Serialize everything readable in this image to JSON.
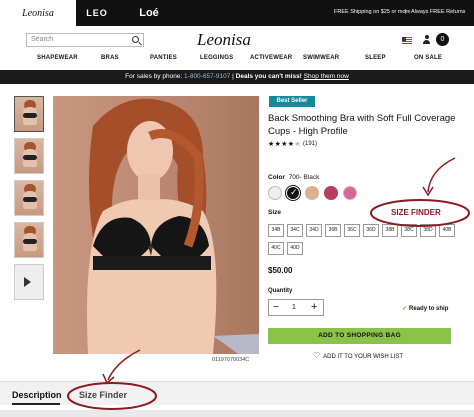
{
  "topbar": {
    "brands": [
      "Leonisa",
      "LEO",
      "Loé"
    ],
    "shipping_msg": "FREE Shipping on $25 or more",
    "separator": "|",
    "returns_msg": "Always FREE Returns"
  },
  "header": {
    "search_placeholder": "Search",
    "logo": "Leonisa",
    "cart_count": "0"
  },
  "nav": [
    "SHAPEWEAR",
    "BRAS",
    "PANTIES",
    "LEGGINGS",
    "ACTIVEWEAR",
    "SWIMWEAR",
    "SLEEP",
    "ON SALE"
  ],
  "promo": {
    "prefix": "For sales by phone:",
    "phone": "1-800-657-9107",
    "divider": "|",
    "deals": "Deals you can't miss!",
    "link": "Shop them now"
  },
  "product": {
    "badge": "Best Seller",
    "title": "Back Smoothing Bra with Soft Full Coverage Cups - High Profile",
    "rating": 4,
    "rating_max": 5,
    "reviews": "(191)",
    "color_label": "Color",
    "color_value": "700- Black",
    "swatch_colors": [
      "#eeeeee",
      "#111111",
      "#d9b190",
      "#b73d61",
      "#d26898"
    ],
    "size_label": "Size",
    "sizes_row1": [
      "34B",
      "34C",
      "34D",
      "36B",
      "36C",
      "36D",
      "38B",
      "38C",
      "38D",
      "40B"
    ],
    "sizes_row2": [
      "40C",
      "40D"
    ],
    "price": "$50.00",
    "quantity_label": "Quantity",
    "quantity": "1",
    "ready_text": "Ready to ship",
    "add_to_bag": "ADD TO SHOPPING BAG",
    "wishlist": "ADD IT TO YOUR WISH LIST",
    "sku": "01197070034C"
  },
  "tabs": [
    "Description",
    "Size Finder"
  ],
  "annotations": {
    "size_finder": "SIZE FINDER",
    "tab_size_finder": "Size Finder",
    "color": "#8b1a22"
  }
}
